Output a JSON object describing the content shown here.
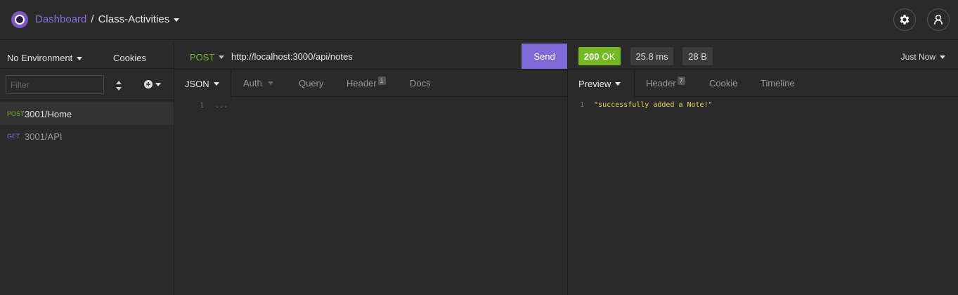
{
  "header": {
    "dashboard_label": "Dashboard",
    "separator": "/",
    "project_label": "Class-Activities"
  },
  "sidebar": {
    "environment_label": "No Environment",
    "cookies_label": "Cookies",
    "filter_placeholder": "Filter",
    "requests": [
      {
        "method": "POST",
        "name": "3001/Home",
        "active": true
      },
      {
        "method": "GET",
        "name": "3001/API",
        "active": false
      }
    ]
  },
  "request": {
    "method": "POST",
    "url": "http://localhost:3000/api/notes",
    "send_label": "Send",
    "tabs": [
      {
        "label": "JSON"
      },
      {
        "label": "Auth"
      },
      {
        "label": "Query"
      },
      {
        "label": "Header",
        "badge": "1"
      },
      {
        "label": "Docs"
      }
    ],
    "editor": {
      "line_number": "1",
      "content": "..."
    }
  },
  "response": {
    "status_code": "200",
    "status_text": "OK",
    "time": "25.8 ms",
    "size": "28 B",
    "timestamp_label": "Just Now",
    "tabs": [
      {
        "label": "Preview"
      },
      {
        "label": "Header",
        "badge": "7"
      },
      {
        "label": "Cookie"
      },
      {
        "label": "Timeline"
      }
    ],
    "body": {
      "line_number": "1",
      "content": "\"successfully added a Note!\""
    }
  },
  "colors": {
    "accent": "#7e6ad6",
    "post_method": "#75ba24",
    "get_method": "#8f6fe0",
    "status_ok": "#75ba24",
    "string_value": "#e5d85a"
  },
  "icons": {
    "logo": "insomnia-logo",
    "settings": "gear-icon",
    "account": "user-icon"
  }
}
